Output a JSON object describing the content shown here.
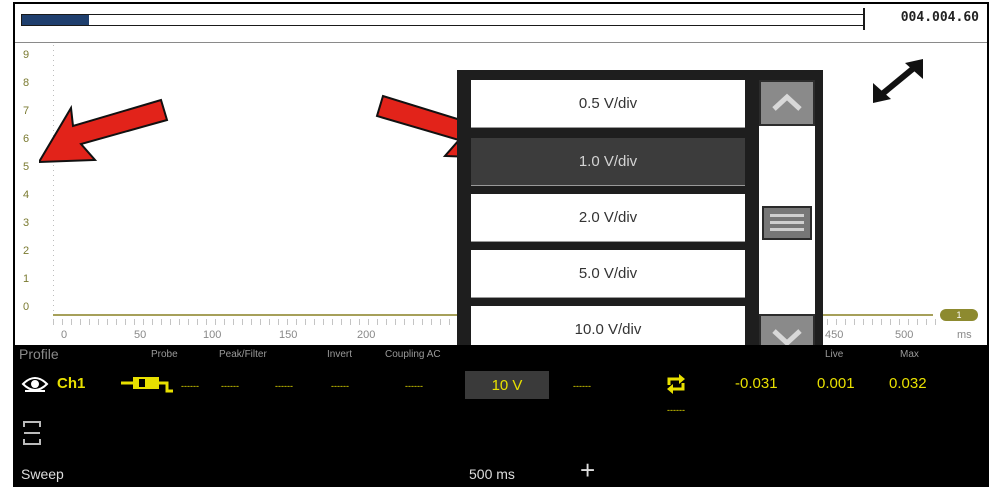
{
  "top": {
    "version": "004.004.60",
    "buffer_progress": 0.08
  },
  "plot": {
    "y_labels": [
      "9",
      "8",
      "7",
      "6",
      "5",
      "4",
      "3",
      "2",
      "1",
      "0"
    ],
    "x_labels": [
      "0",
      "50",
      "100",
      "150",
      "200",
      "450",
      "500"
    ],
    "x_unit": "ms",
    "marker_label": "1"
  },
  "dropdown": {
    "options": [
      "0.5 V/div",
      "1.0 V/div",
      "2.0 V/div",
      "5.0 V/div",
      "10.0 V/div"
    ],
    "selected": "1.0 V/div"
  },
  "panel": {
    "profile_label": "Profile",
    "headers": {
      "probe": "Probe",
      "peak_filter": "Peak/Filter",
      "invert": "Invert",
      "coupling": "Coupling AC",
      "live": "Live",
      "max": "Max"
    },
    "channel": "Ch1",
    "placeholder": "------",
    "scale": "10 V",
    "readings": {
      "min": "-0.031",
      "live": "0.001",
      "max": "0.032"
    },
    "sweep_label": "Sweep",
    "sweep_value": "500 ms"
  },
  "colors": {
    "accent_yellow": "#e8e000",
    "arrow_red": "#e2231a",
    "trace": "#a6a05a"
  },
  "icons": [
    "fullscreen-icon",
    "eye-icon",
    "probe-icon",
    "refresh-icon",
    "cursor-icon",
    "plus-icon",
    "chevron-up-icon",
    "chevron-down-icon",
    "scroll-thumb-icon"
  ]
}
